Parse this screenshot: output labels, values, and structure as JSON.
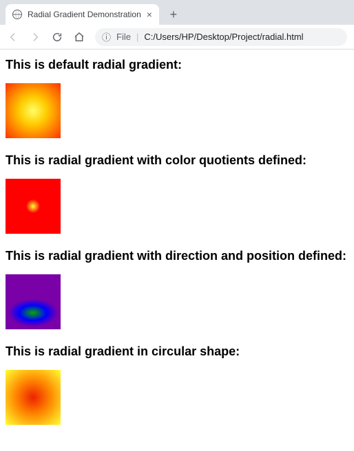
{
  "browser": {
    "tab_title": "Radial Gradient Demonstration",
    "new_tab_plus": "+",
    "close_x": "×",
    "address_prefix": "File",
    "address_path": "C:/Users/HP/Desktop/Project/radial.html",
    "info_glyph": "ⓘ"
  },
  "sections": {
    "s1": "This is default radial gradient:",
    "s2": "This is radial gradient with color quotients defined:",
    "s3": "This is radial gradient with direction and position defined:",
    "s4": "This is radial gradient in circular shape:"
  }
}
